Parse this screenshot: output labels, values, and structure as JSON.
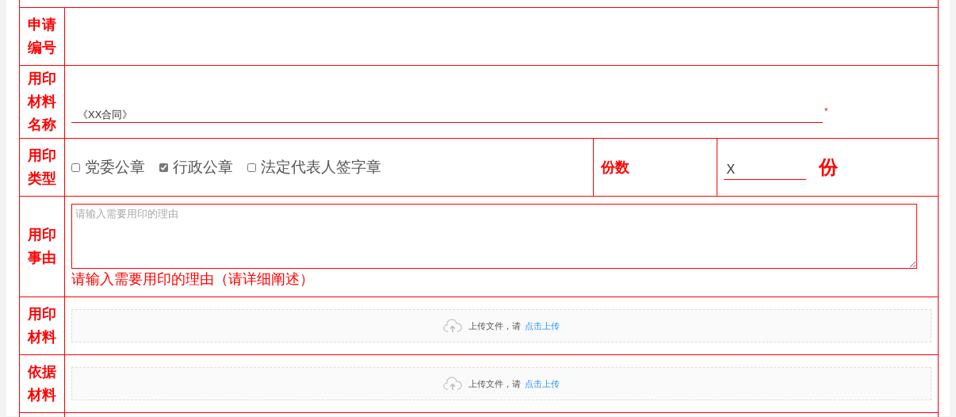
{
  "rows": [
    {
      "kind": "blank",
      "label": "申请编号"
    },
    {
      "kind": "text",
      "label": "用印材料名称",
      "value": "《XX合同》",
      "required_mark": "*"
    },
    {
      "kind": "seal",
      "label": "用印类型",
      "options": [
        {
          "label": "党委公章",
          "checked": false
        },
        {
          "label": "行政公章",
          "checked": true
        },
        {
          "label": "法定代表人签字章",
          "checked": false
        }
      ],
      "copies_label": "份数",
      "copies_value": "X",
      "copies_unit": "份"
    },
    {
      "kind": "textarea",
      "label": "用印事由",
      "placeholder": "请输入需要用印的理由",
      "hint": "请输入需要用印的理由（请详细阐述）"
    },
    {
      "kind": "upload",
      "label": "用印材料",
      "text": "上传文件，请",
      "link": "点击上传"
    },
    {
      "kind": "upload",
      "label": "依据材料",
      "text": "上传文件，请",
      "link": "点击上传"
    }
  ]
}
